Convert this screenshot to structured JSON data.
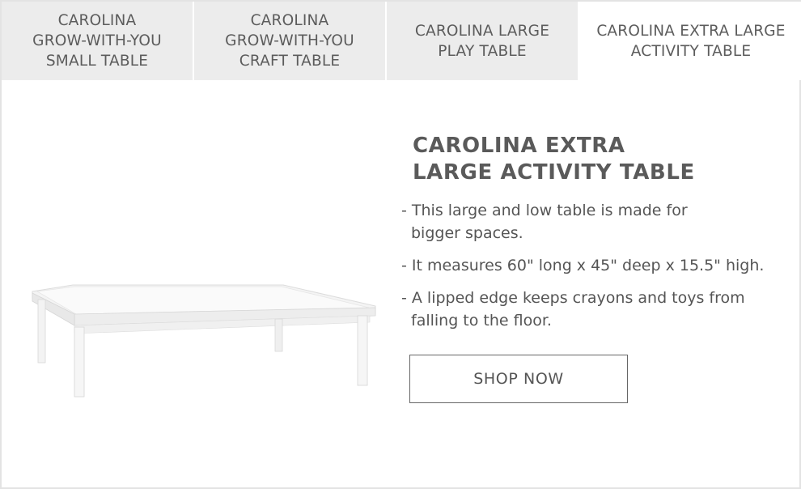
{
  "tabs": [
    {
      "label": "CAROLINA\nGROW-WITH-YOU\nSMALL TABLE",
      "active": false
    },
    {
      "label": "CAROLINA\nGROW-WITH-YOU\nCRAFT TABLE",
      "active": false
    },
    {
      "label": "CAROLINA LARGE\nPLAY TABLE",
      "active": false
    },
    {
      "label": "CAROLINA EXTRA LARGE\nACTIVITY TABLE",
      "active": true
    }
  ],
  "product": {
    "title": "CAROLINA EXTRA\nLARGE ACTIVITY TABLE",
    "bullets": [
      "- This large and low table is made for\nbigger spaces.",
      "- It measures 60\" long x 45\" deep x 15.5\" high.",
      "- A lipped edge keeps crayons and toys from\nfalling to the floor."
    ],
    "cta_label": "SHOP NOW",
    "image_icon": "activity-table-image"
  },
  "colors": {
    "tab_inactive_bg": "#ececec",
    "tab_active_bg": "#ffffff",
    "text": "#555555",
    "border": "#e3e3e3"
  }
}
